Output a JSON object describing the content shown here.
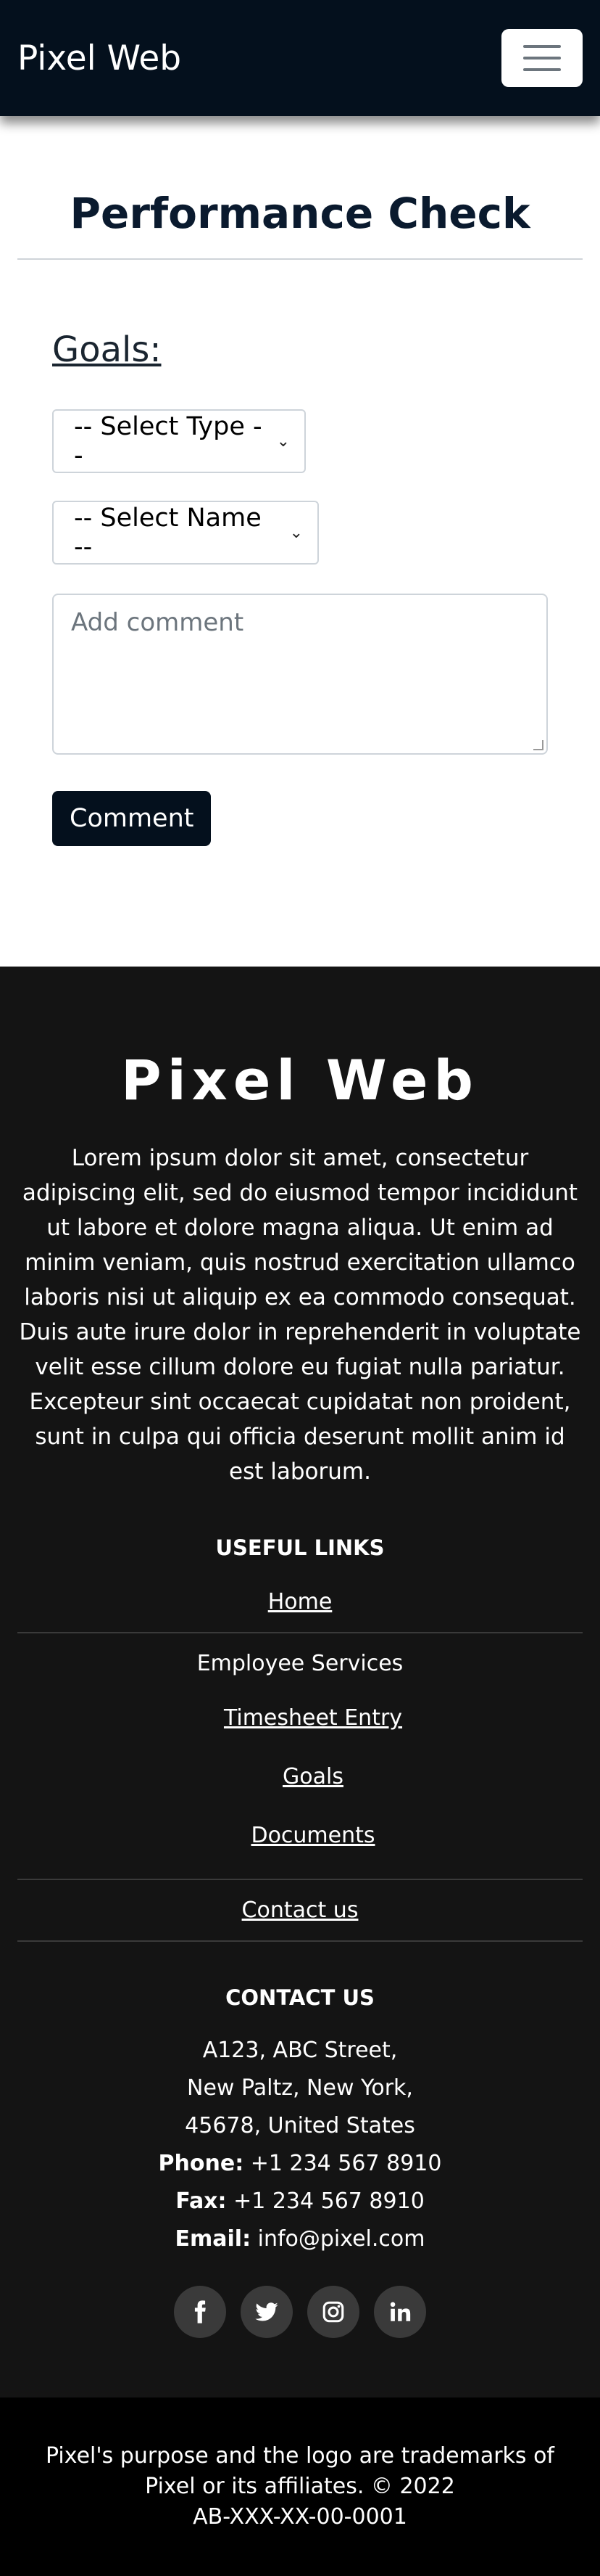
{
  "navbar": {
    "brand": "Pixel Web"
  },
  "main": {
    "title": "Performance Check",
    "goals_label": "Goals:",
    "select_type": "-- Select Type --",
    "select_name": "-- Select Name --",
    "comment_placeholder": "Add comment",
    "comment_button": "Comment"
  },
  "footer": {
    "brand": "Pixel Web",
    "description": "Lorem ipsum dolor sit amet, consectetur adipiscing elit, sed do eiusmod tempor incididunt ut labore et dolore magna aliqua. Ut enim ad minim veniam, quis nostrud exercitation ullamco laboris nisi ut aliquip ex ea commodo consequat. Duis aute irure dolor in reprehenderit in voluptate velit esse cillum dolore eu fugiat nulla pariatur. Excepteur sint occaecat cupidatat non proident, sunt in culpa qui officia deserunt mollit anim id est laborum.",
    "useful_links_heading": "USEFUL LINKS",
    "links": {
      "home": "Home",
      "employee_services": "Employee Services",
      "timesheet": "Timesheet Entry",
      "goals": "Goals",
      "documents": "Documents",
      "contact": "Contact us"
    },
    "contact_heading": "CONTACT US",
    "address": [
      "A123, ABC Street,",
      "New Paltz, New York,",
      "45678, United States"
    ],
    "phone_label": "Phone:",
    "phone": "+1 234 567 8910",
    "fax_label": "Fax:",
    "fax": "+1 234 567 8910",
    "email_label": "Email:",
    "email": "info@pixel.com",
    "socials": [
      "facebook-icon",
      "twitter-icon",
      "instagram-icon",
      "linkedin-icon"
    ]
  },
  "copyright": {
    "line1": "Pixel's purpose and the logo are trademarks of Pixel or its affiliates. © 2022",
    "line2": "AB-XXX-XX-00-0001"
  }
}
